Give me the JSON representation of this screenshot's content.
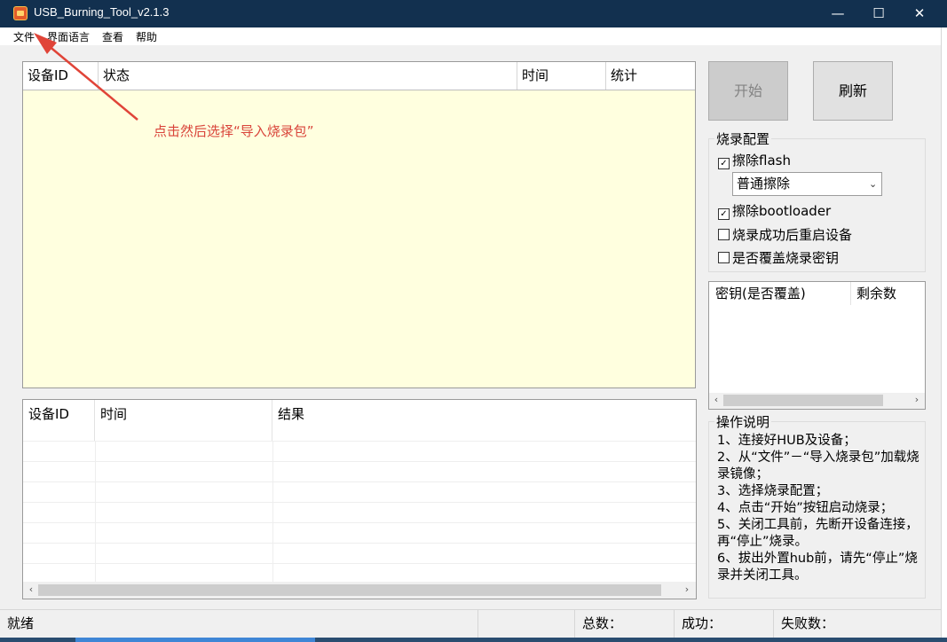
{
  "window": {
    "title": "USB_Burning_Tool_v2.1.3",
    "controls": {
      "minimize": "—",
      "maximize": "☐",
      "close": "✕"
    }
  },
  "menu": {
    "items": [
      "文件",
      "界面语言",
      "查看",
      "帮助"
    ]
  },
  "main_list": {
    "columns": [
      "设备ID",
      "状态",
      "时间",
      "统计"
    ],
    "rows": []
  },
  "annotation": {
    "text": "点击然后选择“导入烧录包”",
    "color": "#d9443a"
  },
  "result_list": {
    "columns": [
      "设备ID",
      "时间",
      "结果"
    ],
    "rows": []
  },
  "buttons": {
    "start": "开始",
    "refresh": "刷新"
  },
  "burn_config": {
    "label": "烧录配置",
    "erase_flash": {
      "label": "擦除flash",
      "checked": true
    },
    "erase_mode": {
      "selected": "普通擦除"
    },
    "erase_bootloader": {
      "label": "擦除bootloader",
      "checked": true
    },
    "reboot_after": {
      "label": "烧录成功后重启设备",
      "checked": false
    },
    "overwrite_key": {
      "label": "是否覆盖烧录密钥",
      "checked": false
    }
  },
  "key_list": {
    "columns": [
      "密钥(是否覆盖)",
      "剩余数"
    ]
  },
  "instructions": {
    "label": "操作说明",
    "lines": [
      "1、连接好HUB及设备；",
      "2、从“文件”－“导入烧录包”加载烧录镜像；",
      "3、选择烧录配置；",
      "4、点击“开始”按钮启动烧录；",
      "5、关闭工具前，先断开设备连接，再“停止”烧录。",
      "6、拔出外置hub前，请先“停止”烧录并关闭工具。"
    ]
  },
  "status": {
    "ready": "就绪",
    "total": "总数：",
    "success": "成功：",
    "fail": "失败数："
  },
  "icons": {
    "app": "usb-burning-tool-icon",
    "checkbox_checked": "☑",
    "combo_arrow": "chevron-down-icon"
  },
  "colors": {
    "titlebar": "#12304f",
    "list_bg": "#ffffdf",
    "accent_annotation": "#d9443a"
  }
}
